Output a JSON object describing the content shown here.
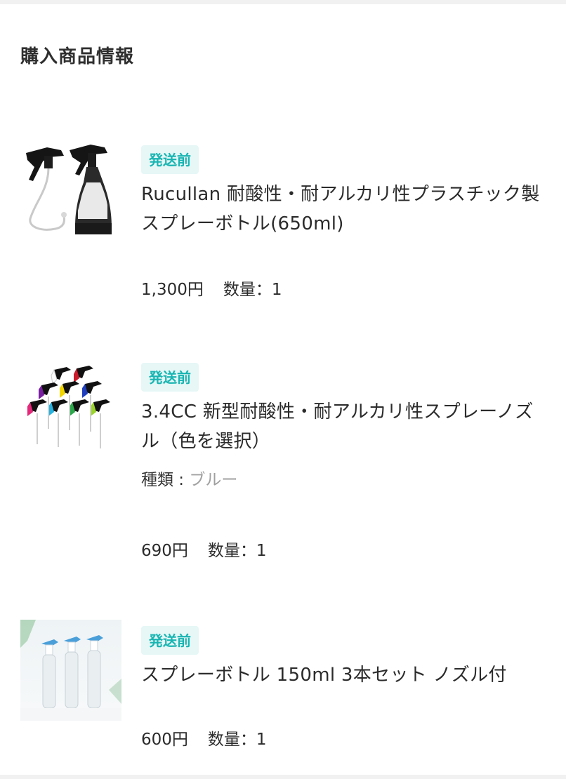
{
  "section": {
    "title": "購入商品情報"
  },
  "items": [
    {
      "status": "発送前",
      "name": "Rucullan 耐酸性・耐アルカリ性プラスチック製スプレーボトル(650ml)",
      "price": "1,300円",
      "quantity": "数量：1"
    },
    {
      "status": "発送前",
      "name": "3.4CC 新型耐酸性・耐アルカリ性スプレーノズル（色を選択）",
      "variant_label": "種類 : ",
      "variant_value": "ブルー",
      "price": "690円",
      "quantity": "数量：1"
    },
    {
      "status": "発送前",
      "name": "スプレーボトル 150ml 3本セット ノズル付",
      "price": "600円",
      "quantity": "数量：1"
    }
  ],
  "colors": {
    "badge_bg": "#e6f7f6",
    "badge_text": "#19b5b2",
    "variant_value": "#a0a0a0"
  }
}
